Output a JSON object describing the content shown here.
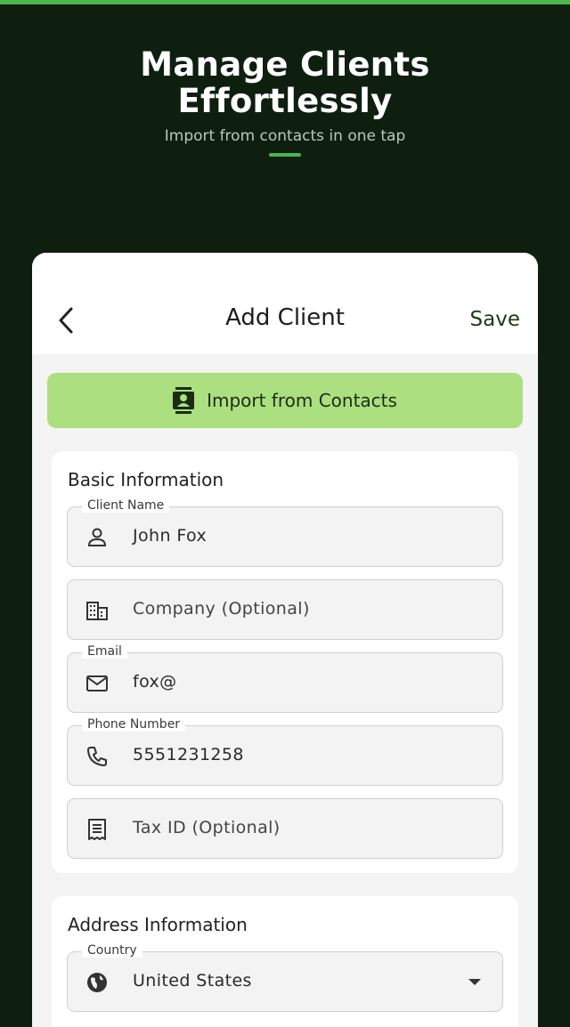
{
  "hero": {
    "title_line1": "Manage Clients",
    "title_line2": "Effortlessly",
    "subtitle": "Import from contacts in one tap"
  },
  "appbar": {
    "title": "Add Client",
    "save_label": "Save"
  },
  "import_button": {
    "label": "Import from Contacts"
  },
  "basic_info": {
    "title": "Basic Information",
    "fields": [
      {
        "label": "Client Name",
        "value": "John Fox",
        "icon": "person-icon"
      },
      {
        "label": "",
        "placeholder": "Company (Optional)",
        "icon": "building-icon"
      },
      {
        "label": "Email",
        "value": "fox@",
        "icon": "mail-icon"
      },
      {
        "label": "Phone Number",
        "value": "5551231258",
        "icon": "phone-icon"
      },
      {
        "label": "",
        "placeholder": "Tax ID (Optional)",
        "icon": "receipt-icon"
      }
    ]
  },
  "address_info": {
    "title": "Address Information",
    "country_label": "Country",
    "country_value": "United States",
    "country_icon": "globe-icon"
  },
  "colors": {
    "background": "#0e1f10",
    "accent": "#4bb54f",
    "import_button_bg": "#acdf7f",
    "save_text": "#1f3a14"
  }
}
